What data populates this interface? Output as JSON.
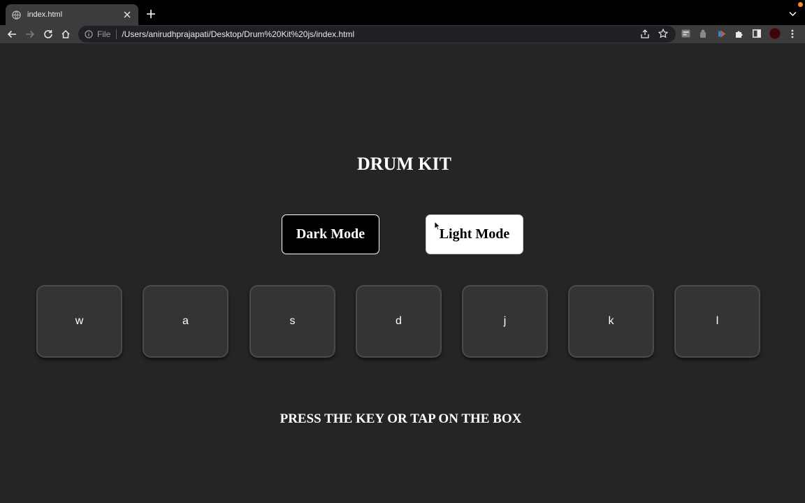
{
  "browser": {
    "tab": {
      "title": "index.html"
    },
    "address": {
      "scheme_label": "File",
      "url": "/Users/anirudhprajapati/Desktop/Drum%20Kit%20js/index.html"
    }
  },
  "page": {
    "heading": "DRUM KIT",
    "modes": {
      "dark_label": "Dark Mode",
      "light_label": "Light Mode"
    },
    "drums": [
      "w",
      "a",
      "s",
      "d",
      "j",
      "k",
      "l"
    ],
    "instruction": "PRESS THE KEY OR TAP ON THE BOX"
  },
  "colors": {
    "background": "#252525",
    "drum_fill": "#353433",
    "drum_border": "#4a4a4a",
    "dark_button": "#000000",
    "light_button": "#ffffff",
    "text": "#ffffff"
  },
  "icons": {
    "toolbar": [
      "back-icon",
      "forward-icon",
      "reload-icon",
      "home-icon"
    ],
    "omnibox": [
      "info-icon",
      "share-icon",
      "bookmark-star-icon"
    ],
    "extensions": [
      "extension-1-icon",
      "extension-2-icon",
      "extension-3-icon",
      "puzzle-icon",
      "side-panel-icon",
      "profile-avatar-icon",
      "menu-kebab-icon"
    ]
  }
}
